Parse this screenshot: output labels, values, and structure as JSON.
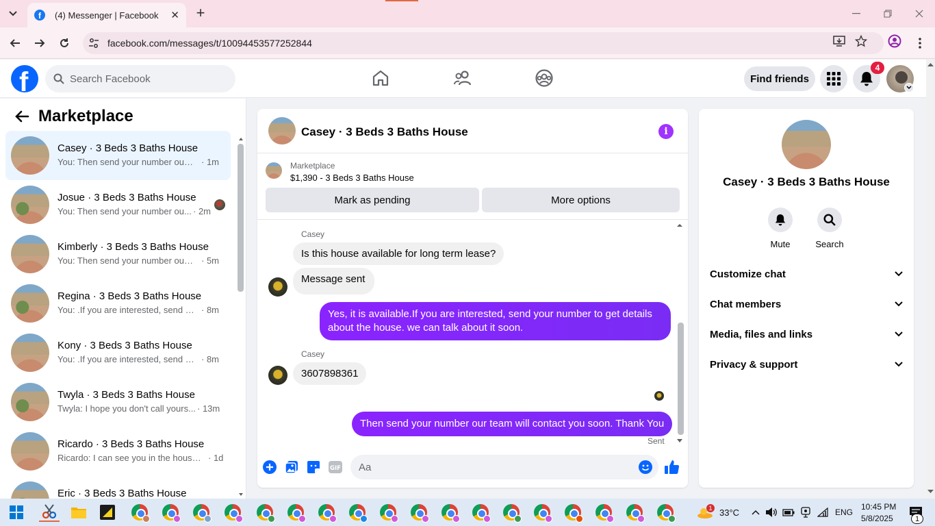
{
  "browser": {
    "tab_title": "(4) Messenger | Facebook",
    "tab_close": "✕",
    "new_tab": "+",
    "url": "facebook.com/messages/t/10094453577252844"
  },
  "fb": {
    "logo_letter": "f",
    "search_placeholder": "Search Facebook",
    "find_friends": "Find friends",
    "notification_count": "4"
  },
  "sidebar": {
    "title": "Marketplace",
    "conversations": [
      {
        "name": "Casey · 3 Beds 3 Baths House",
        "preview": "You: Then send your number our t...",
        "time": "· 1m"
      },
      {
        "name": "Josue · 3 Beds 3 Baths House",
        "preview": "You: Then send your number ou...",
        "time": "· 2m"
      },
      {
        "name": "Kimberly · 3 Beds 3 Baths House",
        "preview": "You: Then send your number our t...",
        "time": "· 5m"
      },
      {
        "name": "Regina · 3 Beds 3 Baths House",
        "preview": "You: .If you are interested, send yo...",
        "time": "· 8m"
      },
      {
        "name": "Kony · 3 Beds 3 Baths House",
        "preview": "You: .If you are interested, send yo...",
        "time": "· 8m"
      },
      {
        "name": "Twyla · 3 Beds 3 Baths House",
        "preview": "Twyla: I hope you don't call yours...",
        "time": "· 13m"
      },
      {
        "name": "Ricardo · 3 Beds 3 Baths House",
        "preview": "Ricardo: I can see you in the house ...",
        "time": "· 1d"
      },
      {
        "name": "Eric · 3 Beds 3 Baths House",
        "preview": "",
        "time": ""
      }
    ]
  },
  "chat": {
    "title": "Casey · 3 Beds 3 Baths House",
    "info_glyph": "i",
    "marketplace_label": "Marketplace",
    "listing": "$1,390 - 3 Beds 3 Baths House",
    "mark_pending": "Mark as pending",
    "more_options": "More options",
    "messages": [
      {
        "sender": "Casey",
        "text": "Is this house available for long term lease?"
      },
      {
        "sender": "",
        "text": "Message sent"
      },
      {
        "sender": "me",
        "text": "Yes, it is available.If you are interested, send your number to get details about the house. we can talk about it soon."
      },
      {
        "sender": "Casey",
        "text": "3607898361"
      },
      {
        "sender": "me",
        "text": "Then send your number our team will contact you soon. Thank You"
      }
    ],
    "sent_status": "Sent",
    "composer_placeholder": "Aa"
  },
  "info_panel": {
    "name": "Casey · 3 Beds 3 Baths House",
    "mute": "Mute",
    "search": "Search",
    "sections": [
      "Customize chat",
      "Chat members",
      "Media, files and links",
      "Privacy & support"
    ]
  },
  "taskbar": {
    "weather_badge": "1",
    "temperature": "33°C",
    "language": "ENG",
    "time": "10:45 PM",
    "date": "5/8/2025",
    "notif_count": "1"
  },
  "colors": {
    "fb_blue": "#0866ff",
    "messenger_purple": "#7e1fff",
    "badge_red": "#e41e3f"
  }
}
